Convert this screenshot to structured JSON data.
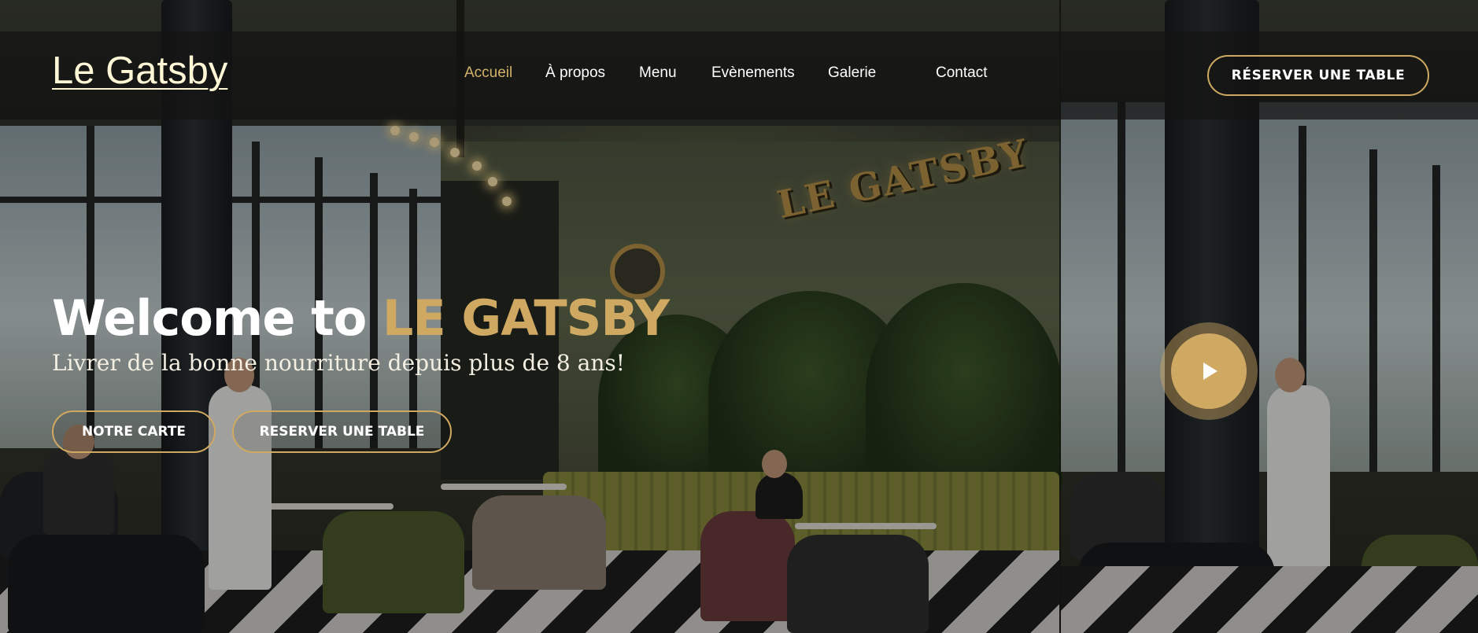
{
  "header": {
    "brand": "Le Gatsby",
    "nav": [
      {
        "label": "Accueil",
        "active": true
      },
      {
        "label": "À propos",
        "active": false
      },
      {
        "label": "Menu",
        "active": false
      },
      {
        "label": "Evènements",
        "active": false
      },
      {
        "label": "Galerie",
        "active": false
      },
      {
        "label": "Contact",
        "active": false
      }
    ],
    "reserve_button": "RÉSERVER UNE TABLE"
  },
  "hero": {
    "title_prefix": "Welcome to",
    "title_highlight": "LE GATSBY",
    "subtitle": "Livrer de la bonne nourriture depuis plus de 8 ans!",
    "menu_button": "NOTRE CARTE",
    "reserve_button": "RESERVER UNE TABLE"
  },
  "background": {
    "wall_sign": "LE GATSBY"
  },
  "video": {
    "icon": "play-icon"
  },
  "colors": {
    "accent": "#cfa962",
    "active_nav": "#d3b16a",
    "brand_text": "#fff7d6",
    "header_bg": "rgba(20,20,18,0.72)"
  }
}
